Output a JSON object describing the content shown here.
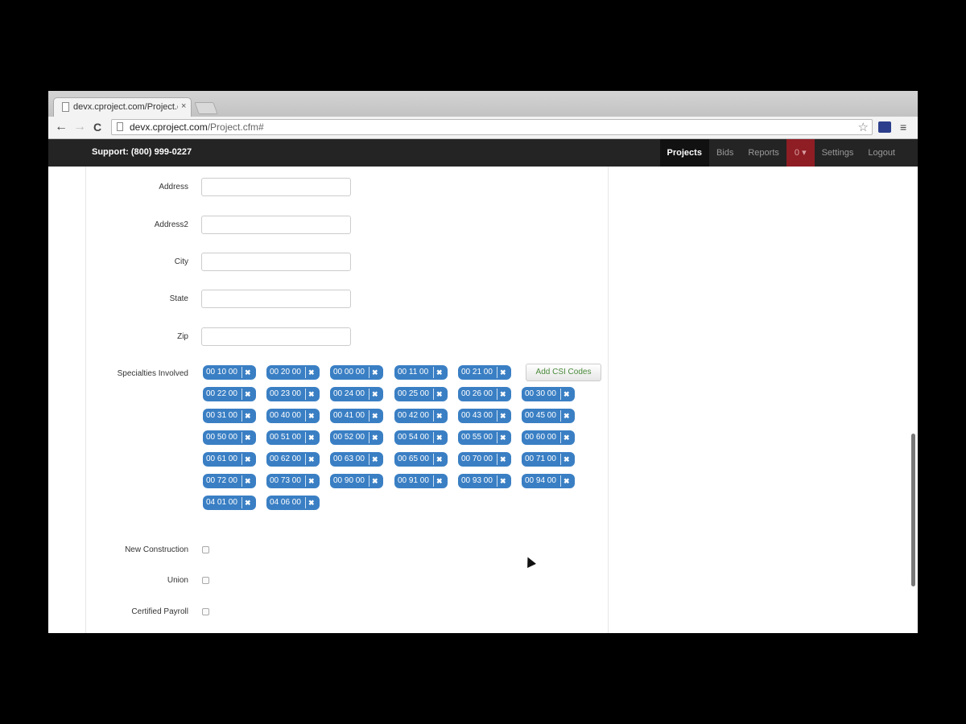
{
  "browser": {
    "tab_title": "devx.cproject.com/Project.c",
    "tab_close": "×",
    "url_host": "devx.cproject.com",
    "url_path": "/Project.cfm#",
    "back": "←",
    "forward": "→",
    "reload": "C",
    "star": "☆",
    "menu": "≡"
  },
  "navbar": {
    "support": "Support: (800) 999-0227",
    "links": [
      {
        "label": "Projects",
        "active": true
      },
      {
        "label": "Bids"
      },
      {
        "label": "Reports"
      },
      {
        "label": "0 ▾",
        "badge": true
      },
      {
        "label": "Settings"
      },
      {
        "label": "Logout"
      }
    ]
  },
  "form": {
    "fields": [
      {
        "label": "Address",
        "value": ""
      },
      {
        "label": "Address2",
        "value": ""
      },
      {
        "label": "City",
        "value": ""
      },
      {
        "label": "State",
        "value": ""
      },
      {
        "label": "Zip",
        "value": ""
      }
    ],
    "specialties_label": "Specialties Involved",
    "add_button": "Add CSI Codes",
    "chip_remove": "✖",
    "codes": [
      [
        "00 10 00",
        "00 20 00",
        "00 00 00",
        "00 11 00",
        "00 21 00"
      ],
      [
        "00 22 00",
        "00 23 00",
        "00 24 00",
        "00 25 00",
        "00 26 00",
        "00 30 00"
      ],
      [
        "00 31 00",
        "00 40 00",
        "00 41 00",
        "00 42 00",
        "00 43 00",
        "00 45 00"
      ],
      [
        "00 50 00",
        "00 51 00",
        "00 52 00",
        "00 54 00",
        "00 55 00",
        "00 60 00"
      ],
      [
        "00 61 00",
        "00 62 00",
        "00 63 00",
        "00 65 00",
        "00 70 00",
        "00 71 00"
      ],
      [
        "00 72 00",
        "00 73 00",
        "00 90 00",
        "00 91 00",
        "00 93 00",
        "00 94 00"
      ],
      [
        "04 01 00",
        "04 06 00"
      ]
    ],
    "checkboxes": [
      {
        "label": "New Construction",
        "checked": false
      },
      {
        "label": "Union",
        "checked": false
      },
      {
        "label": "Certified Payroll",
        "checked": false
      }
    ]
  }
}
